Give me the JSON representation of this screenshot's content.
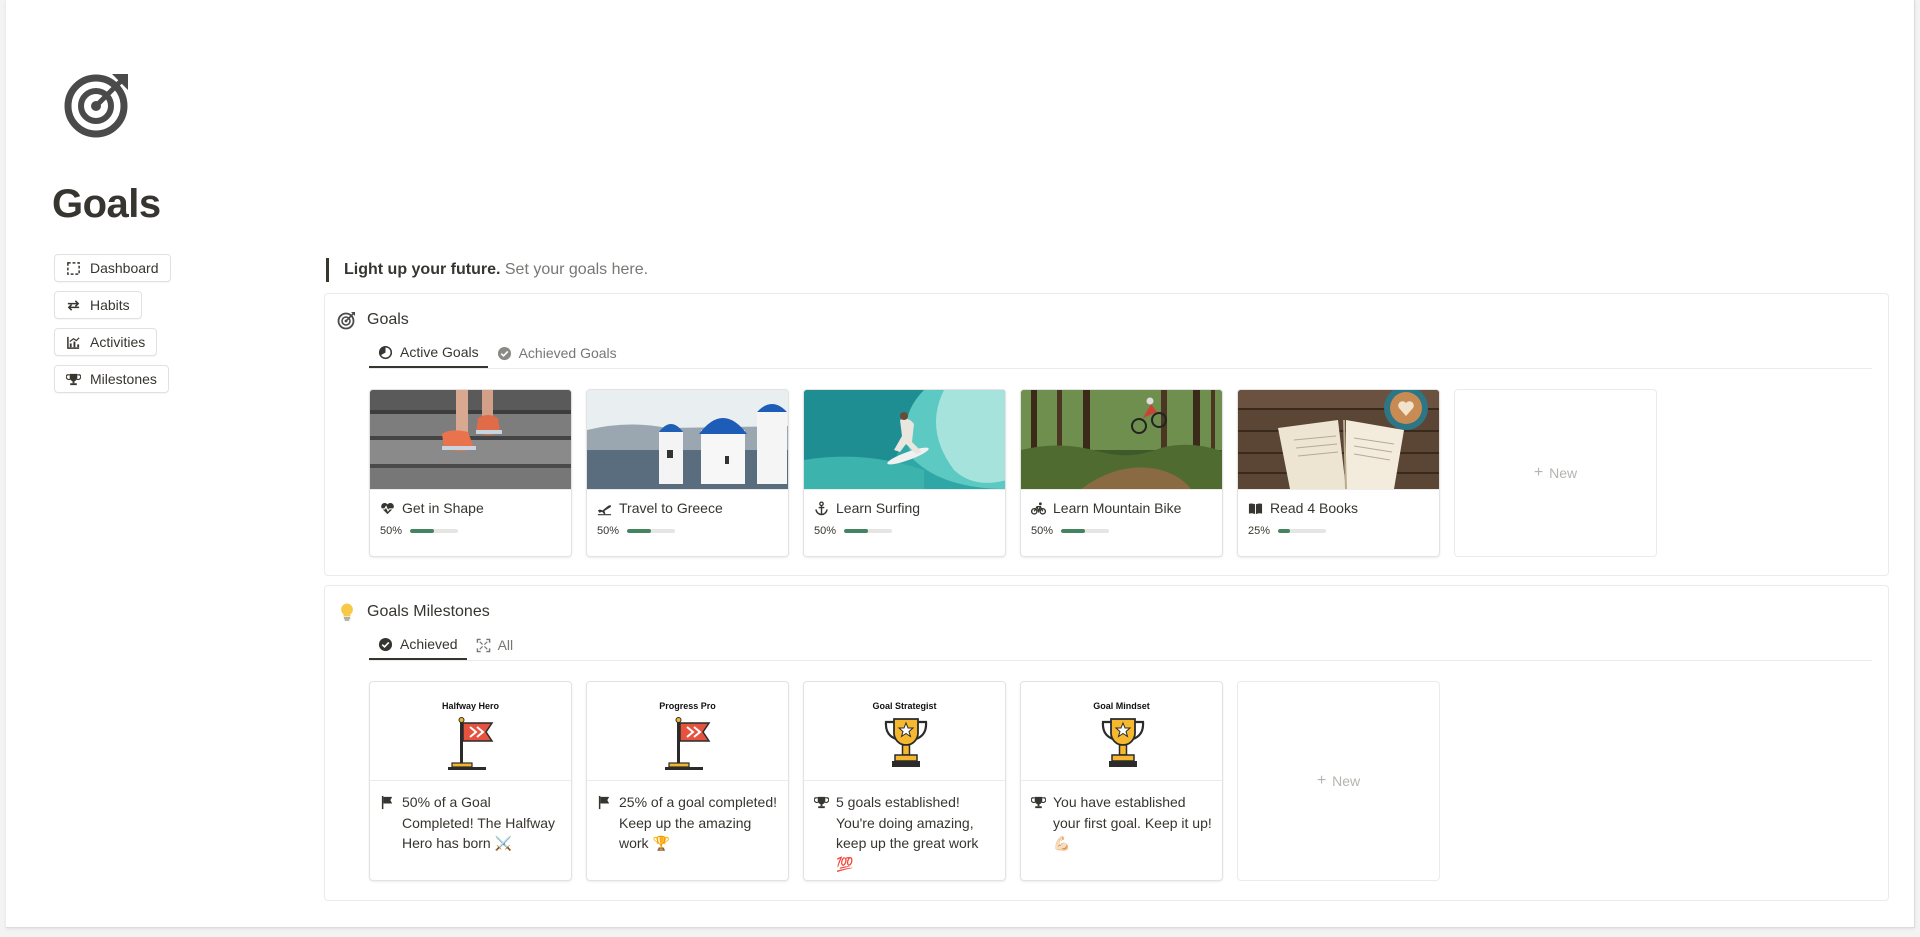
{
  "page": {
    "title": "Goals",
    "icon": "target-icon"
  },
  "nav": [
    {
      "label": "Dashboard",
      "icon": "dashboard-icon"
    },
    {
      "label": "Habits",
      "icon": "repeat-icon"
    },
    {
      "label": "Activities",
      "icon": "chart-icon"
    },
    {
      "label": "Milestones",
      "icon": "trophy-icon"
    }
  ],
  "quote": {
    "bold": "Light up your future.",
    "text": " Set your goals here."
  },
  "goals": {
    "heading": "Goals",
    "tabs": [
      {
        "label": "Active Goals",
        "active": true
      },
      {
        "label": "Achieved Goals",
        "active": false
      }
    ],
    "cards": [
      {
        "title": "Get in Shape",
        "icon": "heart-pulse-icon",
        "progress_label": "50%",
        "progress": 0.5,
        "image": "running-shoes-on-stairs"
      },
      {
        "title": "Travel to Greece",
        "icon": "plane-icon",
        "progress_label": "50%",
        "progress": 0.5,
        "image": "santorini-blue-domes"
      },
      {
        "title": "Learn Surfing",
        "icon": "anchor-icon",
        "progress_label": "50%",
        "progress": 0.5,
        "image": "surfer-in-wave"
      },
      {
        "title": "Learn Mountain Bike",
        "icon": "bike-icon",
        "progress_label": "50%",
        "progress": 0.5,
        "image": "mountain-biker-in-forest"
      },
      {
        "title": "Read 4 Books",
        "icon": "book-icon",
        "progress_label": "25%",
        "progress": 0.25,
        "image": "open-book-and-coffee"
      }
    ],
    "new_label": "New"
  },
  "milestones": {
    "heading": "Goals Milestones",
    "tabs": [
      {
        "label": "Achieved",
        "active": true
      },
      {
        "label": "All",
        "active": false
      }
    ],
    "cards": [
      {
        "badge": "Halfway Hero",
        "badge_icon": "flag-icon",
        "icon": "flag-icon",
        "text": "50% of a Goal Completed! The Halfway Hero has born ⚔️"
      },
      {
        "badge": "Progress Pro",
        "badge_icon": "flag-icon",
        "icon": "flag-icon",
        "text": "25% of a goal completed! Keep up the amazing work 🏆"
      },
      {
        "badge": "Goal Strategist",
        "badge_icon": "trophy-icon",
        "icon": "trophy-icon",
        "text": "5 goals established! You're doing amazing, keep up the great work 💯"
      },
      {
        "badge": "Goal Mindset",
        "badge_icon": "trophy-icon",
        "icon": "trophy-icon",
        "text": "You have established your first goal. Keep it up! 💪🏻"
      }
    ],
    "new_label": "New"
  },
  "colors": {
    "text": "#37352f",
    "muted": "#787774",
    "progress": "#448361",
    "border": "#ebebea"
  }
}
